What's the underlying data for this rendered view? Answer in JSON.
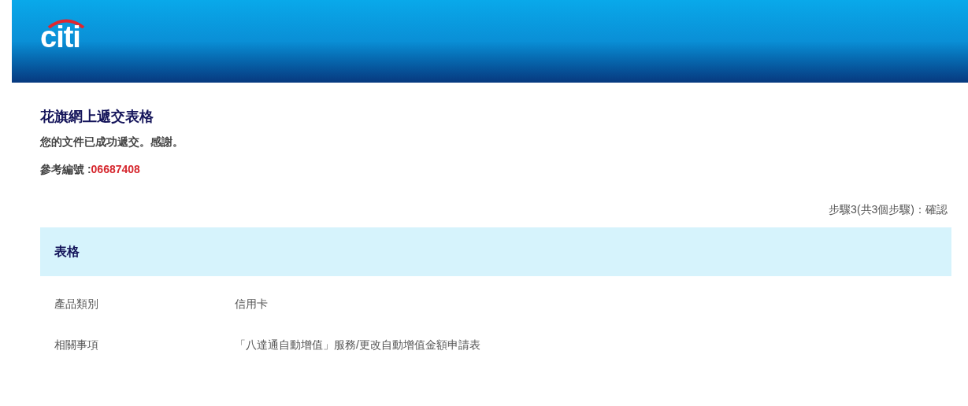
{
  "header": {
    "logo": "citi"
  },
  "title": "花旗網上遞交表格",
  "message": "您的文件已成功遞交。感謝。",
  "reference": {
    "label": "參考編號 :",
    "number": "06687408"
  },
  "step": "步驟3(共3個步驟)：確認",
  "section": {
    "title": "表格",
    "rows": [
      {
        "label": "產品類別",
        "value": "信用卡"
      },
      {
        "label": "相關事項",
        "value": "「八達通自動增值」服務/更改自動增值金額申請表"
      }
    ]
  }
}
